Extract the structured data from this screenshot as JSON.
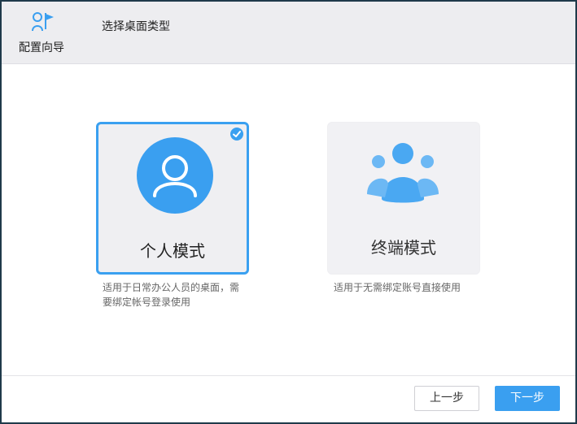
{
  "header": {
    "wizard_label": "配置向导",
    "step_title": "选择桌面类型"
  },
  "cards": {
    "personal": {
      "label": "个人模式",
      "description": "适用于日常办公人员的桌面，需要绑定帐号登录使用",
      "selected": true
    },
    "terminal": {
      "label": "终端模式",
      "description": "适用于无需绑定账号直接使用",
      "selected": false
    }
  },
  "footer": {
    "prev_label": "上一步",
    "next_label": "下一步"
  },
  "icons": [
    "wizard-flag-icon",
    "user-icon",
    "check-icon",
    "user-group-icon"
  ],
  "colors": {
    "accent": "#3a9ff0",
    "header_bg": "#ededf0"
  }
}
